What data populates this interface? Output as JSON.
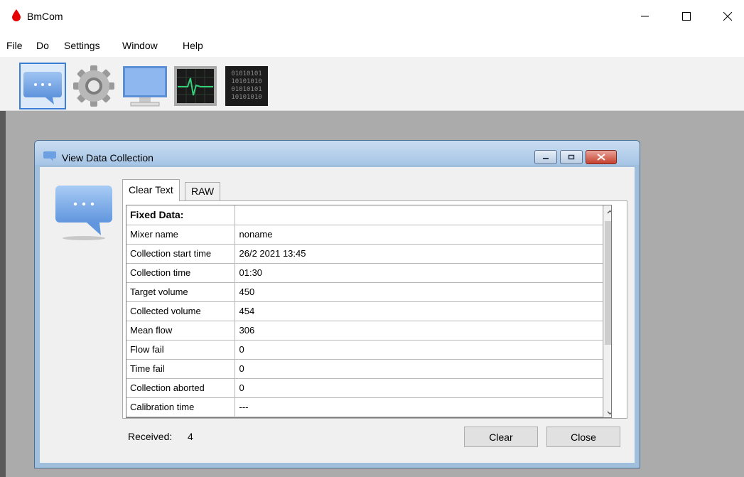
{
  "app": {
    "title": "BmCom",
    "brand_color": "#e60000"
  },
  "menu": [
    "File",
    "Do",
    "Settings",
    "Window",
    "Help"
  ],
  "toolbar": {
    "icons": [
      "chat-bubble-icon",
      "gear-icon",
      "monitor-icon",
      "heartbeat-monitor-icon",
      "binary-data-icon"
    ],
    "binary_text": [
      "01010101",
      "10101010",
      "01010101",
      "10101010"
    ]
  },
  "child_window": {
    "title": "View Data Collection",
    "tabs": [
      {
        "label": "Clear Text",
        "selected": true
      },
      {
        "label": "RAW",
        "selected": false
      }
    ],
    "grid": {
      "header": [
        "Fixed Data:",
        ""
      ],
      "rows": [
        [
          "Mixer name",
          "noname"
        ],
        [
          "Collection start time",
          "26/2 2021 13:45"
        ],
        [
          "Collection time",
          "01:30"
        ],
        [
          "Target volume",
          "450"
        ],
        [
          "Collected volume",
          "454"
        ],
        [
          "Mean flow",
          "306"
        ],
        [
          "Flow fail",
          "0"
        ],
        [
          "Time fail",
          "0"
        ],
        [
          "Collection aborted",
          "0"
        ],
        [
          "Calibration time",
          "---"
        ]
      ]
    },
    "received_label": "Received:",
    "received_count": "4",
    "buttons": {
      "clear": "Clear",
      "close": "Close"
    }
  }
}
